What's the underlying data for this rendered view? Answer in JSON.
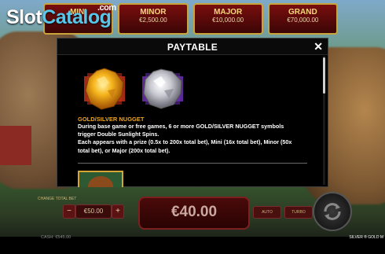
{
  "watermark": {
    "slot": "Slot",
    "catalog": "Catalog",
    "com": ".com"
  },
  "jackpots": [
    {
      "name": "MINI",
      "value": ""
    },
    {
      "name": "MINOR",
      "value": "€2,500.00"
    },
    {
      "name": "MAJOR",
      "value": "€10,000.00"
    },
    {
      "name": "GRAND",
      "value": "€70,000.00"
    }
  ],
  "modal": {
    "title": "PAYTABLE",
    "close": "✕",
    "section_title": "GOLD/SILVER NUGGET",
    "lines": [
      "During base game or free games, 6 or more GOLD/SILVER NUGGET symbols trigger Double Sunlight Spins.",
      "Each appears with a prize (0.5x to 200x total bet), Mini (16x total bet), Minor (50x total bet), or Major (200x total bet)."
    ]
  },
  "bottom": {
    "bet_label": "CHANGE TOTAL BET",
    "bet_value": "€50.00",
    "minus": "−",
    "plus": "+",
    "win_value": "€40.00",
    "auto_label": "AUTO",
    "turbo_label": "TURBO",
    "cash_label": "CASH:",
    "cash_value": "€545.00",
    "game_name": "SILVER ® GOLD M"
  },
  "colors": {
    "accent": "#f0a51c",
    "modal_bg": "#000000",
    "logo_catalog": "#58c6e8"
  }
}
